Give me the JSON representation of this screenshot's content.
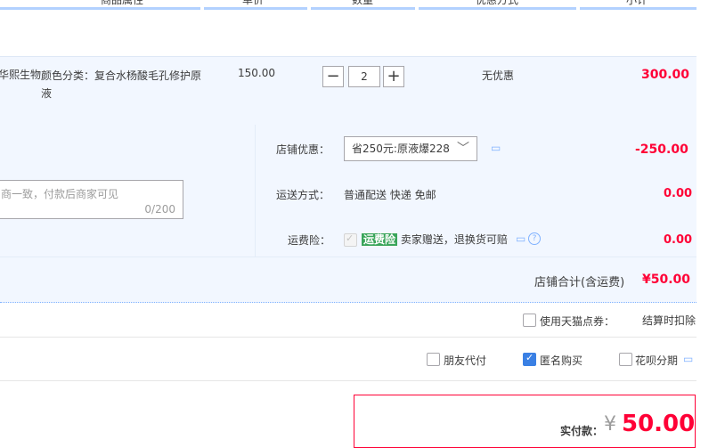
{
  "table_header": {
    "columns": [
      "商品属性",
      "单价",
      "数量",
      "优惠方式",
      "小计"
    ]
  },
  "product": {
    "seller_fragment": "华熙生物",
    "attribute": "颜色分类：复合水杨酸毛孔修护原液",
    "unit_price": "150.00",
    "quantity": "2",
    "discount_method": "无优惠",
    "subtotal": "300.00"
  },
  "shop": {
    "discount_label": "店铺优惠：",
    "discount_select_value": "省250元:原液爆228",
    "discount_amount": "-250.00",
    "shipping_label": "运送方式：",
    "shipping_value": "普通配送 快递 免邮",
    "shipping_amount": "0.00",
    "insurance_label": "运费险：",
    "insurance_badge": "运费险",
    "insurance_text": "卖家赠送，退换货可赔",
    "insurance_amount": "0.00",
    "message_placeholder": "商一致，付款后商家可见",
    "message_counter": "0/200",
    "total_label": "店铺合计(含运费)",
    "total_amount": "¥50.00"
  },
  "options": {
    "tmall_points_label": "使用天猫点券：",
    "settle_note": "结算时扣除",
    "friend_pay_label": "朋友代付",
    "anonymous_label": "匿名购买",
    "huabei_label": "花呗分期"
  },
  "payment": {
    "label": "实付款：",
    "currency": "¥",
    "amount": "50.00"
  },
  "colors": {
    "accent_red": "#ff0036",
    "row_bg": "#f2f7ff",
    "checkbox_blue": "#3a80e4",
    "badge_green": "#3aa55a"
  }
}
